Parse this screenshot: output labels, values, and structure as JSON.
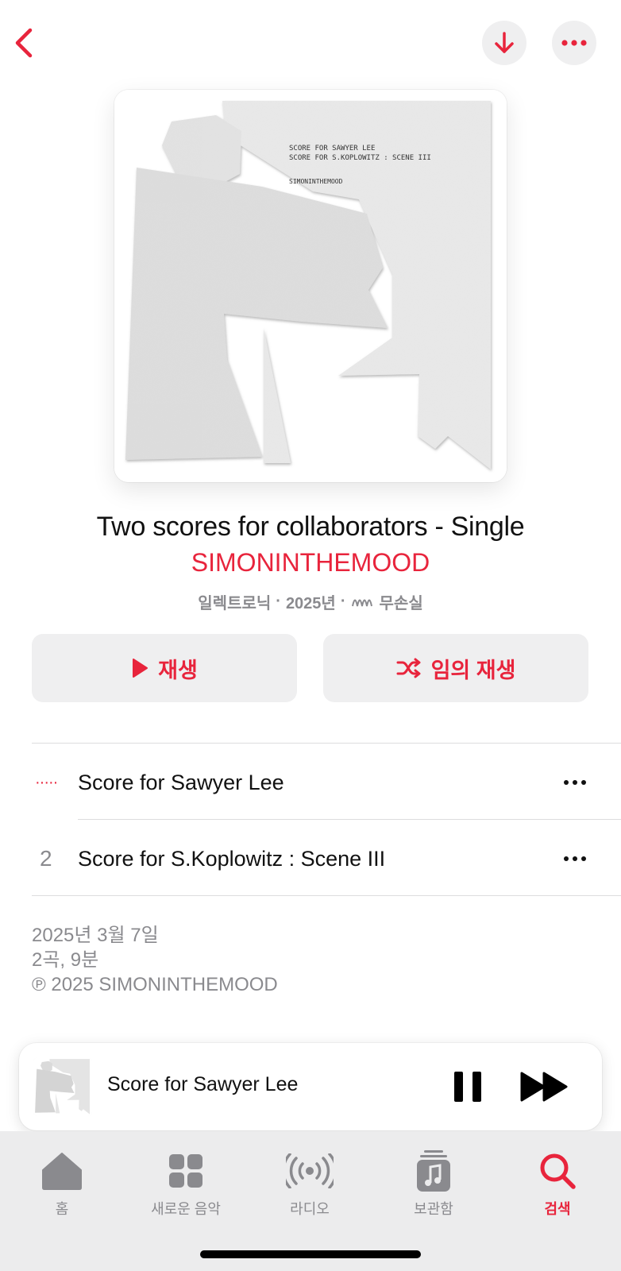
{
  "nav": {
    "back_icon": "chevron-left-icon",
    "download_icon": "arrow-down-icon",
    "more_icon": "ellipsis-icon"
  },
  "album": {
    "art_text_line1": "SCORE FOR SAWYER LEE",
    "art_text_line2": "SCORE FOR S.KOPLOWITZ : SCENE III",
    "art_text_artist": "SIMONINTHEMOOD",
    "title": "Two scores for collaborators - Single",
    "artist": "SIMONINTHEMOOD",
    "genre": "일렉트로닉",
    "year": "2025년",
    "sep": "·",
    "lossless_icon": "lossless-icon",
    "lossless_label": "무손실"
  },
  "actions": {
    "play_label": "재생",
    "shuffle_label": "임의 재생"
  },
  "tracks": [
    {
      "number": "",
      "playing_indicator": "·····",
      "title": "Score for Sawyer Lee",
      "is_playing": true
    },
    {
      "number": "2",
      "title": "Score for S.Koplowitz : Scene III",
      "is_playing": false
    }
  ],
  "footer": {
    "release_date": "2025년 3월 7일",
    "summary": "2곡, 9분",
    "copyright": "℗ 2025 SIMONINTHEMOOD"
  },
  "mini_player": {
    "title": "Score for Sawyer Lee",
    "pause_icon": "pause-icon",
    "forward_icon": "fast-forward-icon"
  },
  "tabs": [
    {
      "label": "홈",
      "icon": "home-icon",
      "active": false
    },
    {
      "label": "새로운 음악",
      "icon": "grid-icon",
      "active": false
    },
    {
      "label": "라디오",
      "icon": "radio-icon",
      "active": false
    },
    {
      "label": "보관함",
      "icon": "library-icon",
      "active": false
    },
    {
      "label": "검색",
      "icon": "search-icon",
      "active": true
    }
  ],
  "colors": {
    "accent": "#e8243c",
    "secondary_text": "#8a8a8e",
    "button_bg": "#efeff0",
    "tabbar_bg": "#ececed"
  }
}
